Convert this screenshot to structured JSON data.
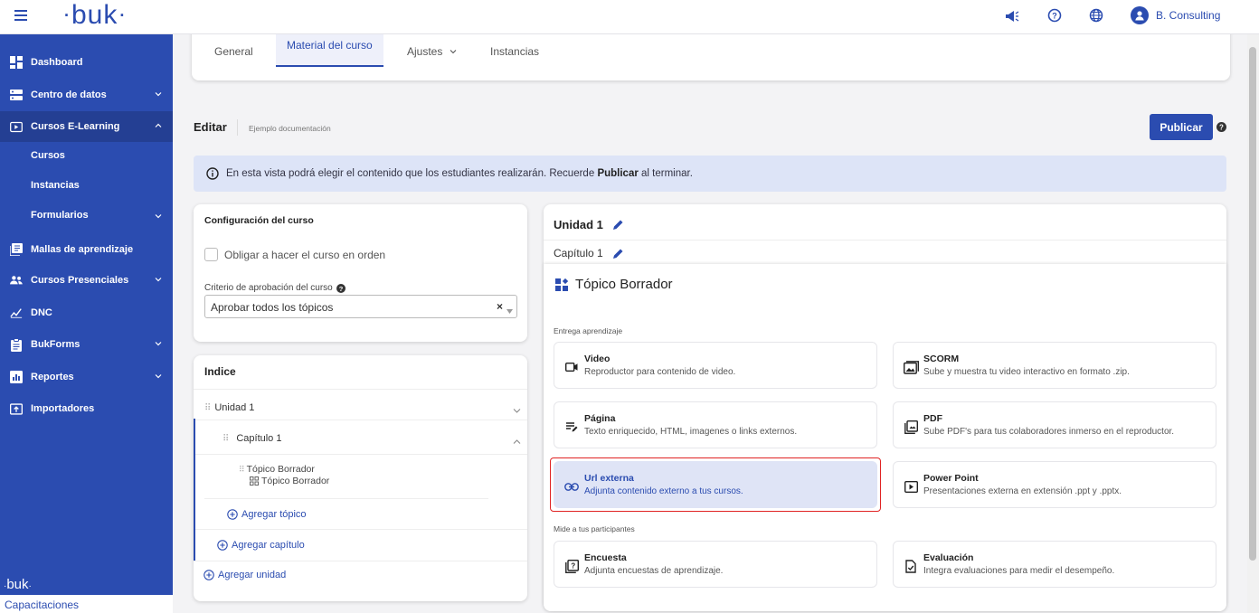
{
  "brand": {
    "logo_text": "buk",
    "footer_logo_text": "buk",
    "footer_label": "Capacitaciones"
  },
  "topbar": {
    "user_name": "B. Consulting"
  },
  "sidebar": {
    "items": [
      {
        "label": "Dashboard"
      },
      {
        "label": "Centro de datos"
      },
      {
        "label": "Cursos E-Learning"
      },
      {
        "label": "Mallas de aprendizaje"
      },
      {
        "label": "Cursos Presenciales"
      },
      {
        "label": "DNC"
      },
      {
        "label": "BukForms"
      },
      {
        "label": "Reportes"
      },
      {
        "label": "Importadores"
      }
    ],
    "subitems": [
      {
        "label": "Cursos"
      },
      {
        "label": "Instancias"
      },
      {
        "label": "Formularios"
      }
    ]
  },
  "tabs": [
    {
      "label": "General"
    },
    {
      "label": "Material del curso"
    },
    {
      "label": "Ajustes"
    },
    {
      "label": "Instancias"
    }
  ],
  "editor": {
    "title": "Editar",
    "subtitle": "Ejemplo documentación",
    "publish_label": "Publicar"
  },
  "info": {
    "before": "En esta vista podrá elegir el contenido que los estudiantes realizarán. Recuerde",
    "bold": "Publicar",
    "after": "al terminar."
  },
  "config": {
    "title": "Configuración del curso",
    "checkbox_label": "Obligar a hacer el curso en orden",
    "criterion_label": "Criterio de aprobación del curso",
    "criterion_value": "Aprobar todos los tópicos"
  },
  "index": {
    "title": "Indice",
    "unit": "Unidad 1",
    "chapter": "Capítulo 1",
    "topic_drag": "Tópico Borrador",
    "topic_name": "Tópico Borrador",
    "add_topic": "Agregar tópico",
    "add_chapter": "Agregar capítulo",
    "add_unit": "Agregar unidad"
  },
  "content": {
    "unit_title": "Unidad 1",
    "chapter_title": "Capítulo 1",
    "topic_title": "Tópico Borrador",
    "section1_label": "Entrega aprendizaje",
    "section2_label": "Mide a tus participantes",
    "options": [
      {
        "title": "Video",
        "desc": "Reproductor para contenido de video.",
        "icon": "video-icon"
      },
      {
        "title": "SCORM",
        "desc": "Sube y muestra tu video interactivo en formato .zip.",
        "icon": "scorm-icon"
      },
      {
        "title": "Página",
        "desc": "Texto enriquecido, HTML, imagenes o links externos.",
        "icon": "page-icon"
      },
      {
        "title": "PDF",
        "desc": "Sube PDF's para tus colaboradores inmerso en el reproductor.",
        "icon": "pdf-icon"
      },
      {
        "title": "Url externa",
        "desc": "Adjunta contenido externo a tus cursos.",
        "icon": "link-icon",
        "selected": true
      },
      {
        "title": "Power Point",
        "desc": "Presentaciones externa en extensión .ppt y .pptx.",
        "icon": "powerpoint-icon"
      },
      {
        "title": "Encuesta",
        "desc": "Adjunta encuestas de aprendizaje.",
        "icon": "survey-icon"
      },
      {
        "title": "Evaluación",
        "desc": "Integra evaluaciones para medir el desempeño.",
        "icon": "evaluation-icon"
      }
    ]
  },
  "colors": {
    "primary": "#2b4cb0",
    "sidebar_bg": "#2b4cb0",
    "info_bg": "#dde4f7",
    "selected_option_bg": "#dfe4f6",
    "highlight_border": "#e02424"
  }
}
